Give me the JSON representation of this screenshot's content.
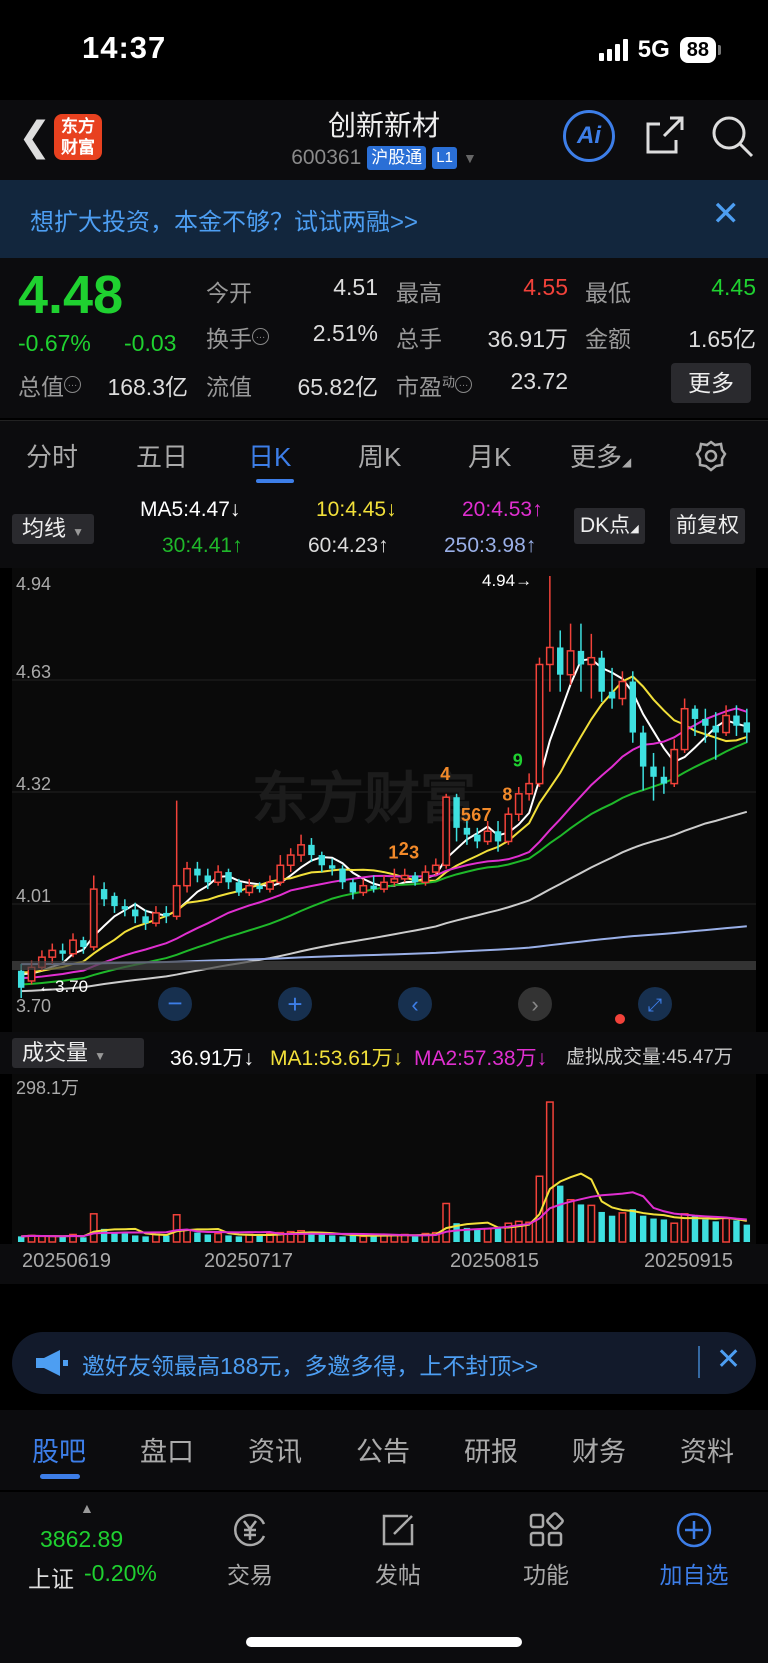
{
  "status": {
    "time": "14:37",
    "network": "5G",
    "battery": "88"
  },
  "header": {
    "logo_text": "东方财富",
    "title": "创新新材",
    "code": "600361",
    "tag": "沪股通",
    "level": "L1",
    "ai_label": "Ai"
  },
  "promo": {
    "text": "想扩大投资，本金不够？试试两融>>"
  },
  "quote": {
    "price": "4.48",
    "change_pct": "-0.67%",
    "change": "-0.03",
    "open_label": "今开",
    "open": "4.51",
    "high_label": "最高",
    "high": "4.55",
    "low_label": "最低",
    "low": "4.45",
    "turnover_label": "换手",
    "turnover": "2.51%",
    "volume_label": "总手",
    "volume": "36.91万",
    "amount_label": "金额",
    "amount": "1.65亿",
    "mktcap_label": "总值",
    "mktcap": "168.3亿",
    "float_label": "流值",
    "float": "65.82亿",
    "pe_label": "市盈",
    "pe_sup": "动",
    "pe": "23.72",
    "more": "更多"
  },
  "tabs": [
    "分时",
    "五日",
    "日K",
    "周K",
    "月K",
    "更多"
  ],
  "chart_head": {
    "indicator": "均线",
    "ma5": "MA5:4.47↓",
    "ma10": "10:4.45↓",
    "ma20": "20:4.53↑",
    "ma30": "30:4.41↑",
    "ma60": "60:4.23↑",
    "ma250": "250:3.98↑",
    "dk": "DK点",
    "adjust": "前复权"
  },
  "colors": {
    "up": "#f2423a",
    "down": "#3ee0e0",
    "ma5": "#ffffff",
    "ma10": "#f2e03a",
    "ma20": "#e02fd0",
    "ma30": "#1fb82a",
    "ma60": "#cccccc",
    "ma250": "#9ab0e8"
  },
  "chart_data": {
    "type": "candlestick",
    "y_ticks": [
      "4.94",
      "4.63",
      "4.32",
      "4.01",
      "3.70"
    ],
    "ylim": [
      3.7,
      4.94
    ],
    "high_label": "4.94→",
    "low_label": "←3.70",
    "watermark": "东方财富",
    "markers": [
      "1",
      "2",
      "3",
      "4",
      "5",
      "6",
      "7",
      "8",
      "9"
    ],
    "candles": [
      [
        3.78,
        3.73,
        3.8,
        3.7
      ],
      [
        3.75,
        3.79,
        3.81,
        3.74
      ],
      [
        3.79,
        3.82,
        3.84,
        3.78
      ],
      [
        3.82,
        3.84,
        3.86,
        3.8
      ],
      [
        3.84,
        3.83,
        3.86,
        3.81
      ],
      [
        3.83,
        3.87,
        3.89,
        3.82
      ],
      [
        3.87,
        3.85,
        3.88,
        3.83
      ],
      [
        3.85,
        4.02,
        4.06,
        3.84
      ],
      [
        4.02,
        3.99,
        4.04,
        3.97
      ],
      [
        4.0,
        3.97,
        4.01,
        3.95
      ],
      [
        3.97,
        3.96,
        3.99,
        3.94
      ],
      [
        3.96,
        3.94,
        3.98,
        3.92
      ],
      [
        3.94,
        3.92,
        3.96,
        3.9
      ],
      [
        3.92,
        3.95,
        3.97,
        3.91
      ],
      [
        3.95,
        3.94,
        3.97,
        3.92
      ],
      [
        3.94,
        4.03,
        4.28,
        3.93
      ],
      [
        4.03,
        4.08,
        4.1,
        4.01
      ],
      [
        4.08,
        4.06,
        4.1,
        4.04
      ],
      [
        4.06,
        4.04,
        4.08,
        4.02
      ],
      [
        4.04,
        4.07,
        4.09,
        4.03
      ],
      [
        4.07,
        4.04,
        4.08,
        4.02
      ],
      [
        4.04,
        4.01,
        4.05,
        4.0
      ],
      [
        4.01,
        4.03,
        4.05,
        4.0
      ],
      [
        4.03,
        4.02,
        4.04,
        4.01
      ],
      [
        4.02,
        4.04,
        4.06,
        4.01
      ],
      [
        4.04,
        4.09,
        4.12,
        4.03
      ],
      [
        4.09,
        4.12,
        4.14,
        4.07
      ],
      [
        4.12,
        4.15,
        4.18,
        4.1
      ],
      [
        4.15,
        4.12,
        4.17,
        4.1
      ],
      [
        4.12,
        4.09,
        4.13,
        4.07
      ],
      [
        4.09,
        4.08,
        4.11,
        4.06
      ],
      [
        4.08,
        4.04,
        4.09,
        4.02
      ],
      [
        4.04,
        4.01,
        4.05,
        3.99
      ],
      [
        4.01,
        4.03,
        4.05,
        4.0
      ],
      [
        4.03,
        4.02,
        4.06,
        4.01
      ],
      [
        4.02,
        4.04,
        4.06,
        4.01
      ],
      [
        4.04,
        4.05,
        4.08,
        4.03
      ],
      [
        4.05,
        4.06,
        4.08,
        4.04
      ],
      [
        4.06,
        4.04,
        4.07,
        4.03
      ],
      [
        4.04,
        4.07,
        4.09,
        4.03
      ],
      [
        4.07,
        4.09,
        4.11,
        4.06
      ],
      [
        4.09,
        4.29,
        4.3,
        4.08
      ],
      [
        4.29,
        4.2,
        4.3,
        4.16
      ],
      [
        4.2,
        4.18,
        4.22,
        4.15
      ],
      [
        4.18,
        4.16,
        4.2,
        4.14
      ],
      [
        4.16,
        4.19,
        4.22,
        4.15
      ],
      [
        4.19,
        4.16,
        4.22,
        4.13
      ],
      [
        4.16,
        4.24,
        4.26,
        4.15
      ],
      [
        4.24,
        4.3,
        4.32,
        4.22
      ],
      [
        4.3,
        4.33,
        4.36,
        4.28
      ],
      [
        4.33,
        4.68,
        4.7,
        4.32
      ],
      [
        4.68,
        4.73,
        4.94,
        4.6
      ],
      [
        4.73,
        4.65,
        4.78,
        4.6
      ],
      [
        4.65,
        4.72,
        4.8,
        4.62
      ],
      [
        4.72,
        4.68,
        4.8,
        4.6
      ],
      [
        4.68,
        4.7,
        4.77,
        4.58
      ],
      [
        4.7,
        4.6,
        4.72,
        4.57
      ],
      [
        4.6,
        4.58,
        4.67,
        4.55
      ],
      [
        4.58,
        4.63,
        4.66,
        4.56
      ],
      [
        4.63,
        4.48,
        4.66,
        4.45
      ],
      [
        4.48,
        4.38,
        4.5,
        4.31
      ],
      [
        4.38,
        4.35,
        4.42,
        4.28
      ],
      [
        4.35,
        4.33,
        4.38,
        4.3
      ],
      [
        4.33,
        4.43,
        4.46,
        4.32
      ],
      [
        4.43,
        4.55,
        4.58,
        4.42
      ],
      [
        4.55,
        4.52,
        4.56,
        4.47
      ],
      [
        4.52,
        4.5,
        4.55,
        4.45
      ],
      [
        4.5,
        4.48,
        4.54,
        4.4
      ],
      [
        4.48,
        4.53,
        4.56,
        4.47
      ],
      [
        4.53,
        4.5,
        4.56,
        4.47
      ],
      [
        4.51,
        4.48,
        4.55,
        4.45
      ]
    ],
    "volume": {
      "label": "成交量",
      "current": "36.91万↓",
      "ma1": "MA1:53.61万↓",
      "ma2": "MA2:57.38万↓",
      "virtual": "虚拟成交量:45.47万",
      "max_label": "298.1万",
      "ylim": [
        0,
        298.1
      ]
    },
    "dates": [
      "20250619",
      "20250717",
      "20250815",
      "20250915"
    ]
  },
  "invite": {
    "text": "邀好友领最高188元，多邀多得，上不封顶>>"
  },
  "sections": [
    "股吧",
    "盘口",
    "资讯",
    "公告",
    "研报",
    "财务",
    "资料"
  ],
  "bottom": {
    "index_value": "3862.89",
    "index_name": "上证",
    "index_change": "-0.20%",
    "trade": "交易",
    "post": "发帖",
    "func": "功能",
    "add": "加自选"
  }
}
